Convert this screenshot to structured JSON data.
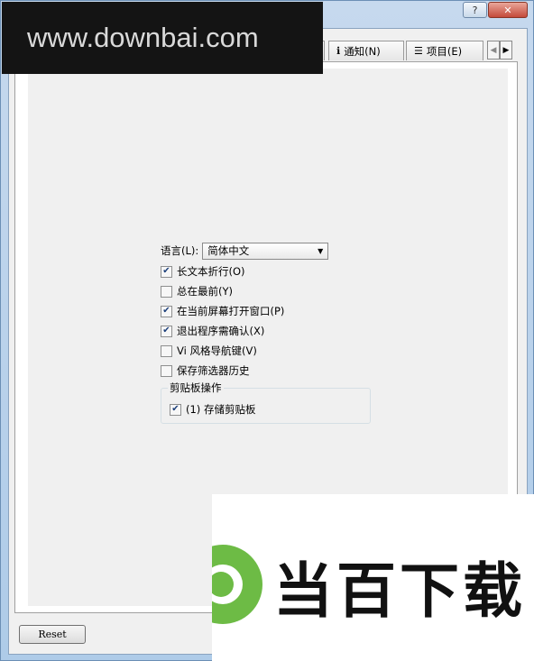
{
  "titlebar": {
    "help_label": "?",
    "close_label": "✕"
  },
  "tabs": [
    {
      "label": "",
      "icon": "tab-icon"
    },
    {
      "label": "通知(N)",
      "icon": "info-icon",
      "icon_glyph": "ℹ"
    },
    {
      "label": "项目(E)",
      "icon": "list-icon",
      "icon_glyph": "☰"
    }
  ],
  "tab_scroll": {
    "left": "◀",
    "right": "▶"
  },
  "settings": {
    "language_label": "语言(L):",
    "language_value": "简体中文",
    "options": [
      {
        "label": "长文本折行(O)",
        "checked": true
      },
      {
        "label": "总在最前(Y)",
        "checked": false
      },
      {
        "label": "在当前屏幕打开窗口(P)",
        "checked": true
      },
      {
        "label": "退出程序需确认(X)",
        "checked": true
      },
      {
        "label": "Vi 风格导航键(V)",
        "checked": false
      },
      {
        "label": "保存筛选器历史",
        "checked": false
      }
    ],
    "clipboard_group": {
      "title": "剪贴板操作",
      "option": {
        "label": "(1) 存储剪贴板",
        "checked": true
      }
    }
  },
  "footer": {
    "reset_label": "Reset"
  },
  "watermark_top": {
    "text": "www.downbai.com"
  },
  "watermark_bottom": {
    "text": "当百下载",
    "brand_color": "#6dbb45"
  }
}
